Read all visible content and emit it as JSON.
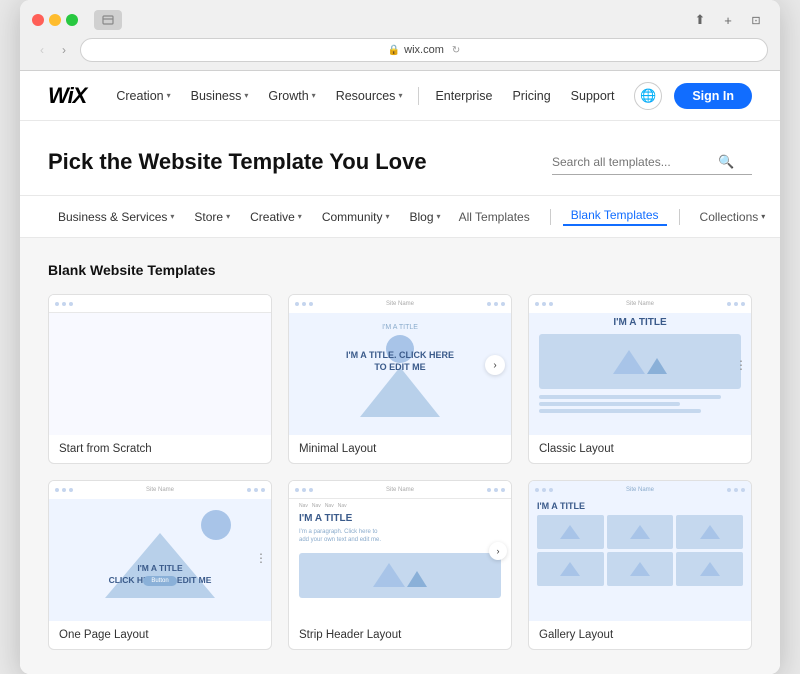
{
  "browser": {
    "url": "wix.com",
    "back_label": "‹",
    "forward_label": "›",
    "lock_icon": "🔒",
    "refresh_icon": "↻",
    "share_icon": "⬆",
    "add_tab_icon": "+",
    "fullscreen_icon": "⊡"
  },
  "nav": {
    "logo": "WiX",
    "items": [
      {
        "label": "Creation",
        "has_dropdown": true
      },
      {
        "label": "Business",
        "has_dropdown": true
      },
      {
        "label": "Growth",
        "has_dropdown": true
      },
      {
        "label": "Resources",
        "has_dropdown": true
      }
    ],
    "plain_items": [
      {
        "label": "Enterprise"
      },
      {
        "label": "Pricing"
      },
      {
        "label": "Support"
      }
    ],
    "sign_in": "Sign In",
    "globe_icon": "🌐"
  },
  "page_header": {
    "title": "Pick the Website Template You Love",
    "search_placeholder": "Search all templates..."
  },
  "sub_nav": {
    "left_items": [
      {
        "label": "Business & Services",
        "has_dropdown": true
      },
      {
        "label": "Store",
        "has_dropdown": true
      },
      {
        "label": "Creative",
        "has_dropdown": true
      },
      {
        "label": "Community",
        "has_dropdown": true
      },
      {
        "label": "Blog",
        "has_dropdown": true
      }
    ],
    "right_items": [
      {
        "label": "All Templates",
        "active": false
      },
      {
        "label": "Blank Templates",
        "active": true
      },
      {
        "label": "Collections",
        "has_dropdown": true,
        "active": false
      }
    ]
  },
  "templates_section": {
    "title": "Blank Website Templates",
    "templates": [
      {
        "id": "scratch",
        "label": "Start from Scratch"
      },
      {
        "id": "minimal",
        "label": "Minimal Layout"
      },
      {
        "id": "classic",
        "label": "Classic Layout"
      },
      {
        "id": "onepage",
        "label": "One Page Layout"
      },
      {
        "id": "strip",
        "label": "Strip Header Layout"
      },
      {
        "id": "gallery",
        "label": "Gallery Layout"
      }
    ]
  }
}
